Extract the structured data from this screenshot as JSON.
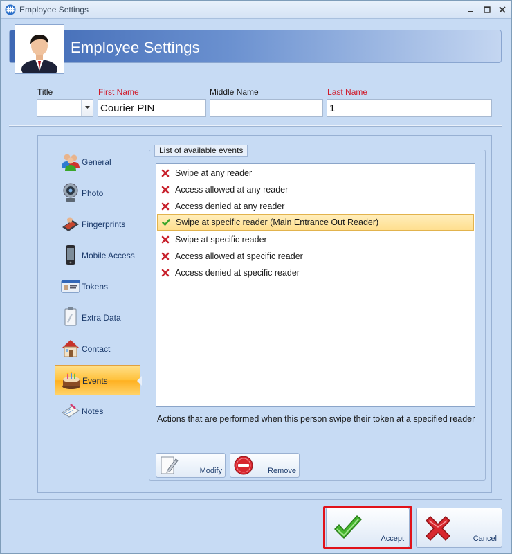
{
  "window": {
    "title": "Employee Settings"
  },
  "header": {
    "title": "Employee Settings"
  },
  "fields": {
    "title_label": "Title",
    "title_value": "",
    "first_name_label_prefix": "F",
    "first_name_label_rest": "irst Name",
    "first_name_value": "Courier PIN",
    "middle_name_label_prefix": "M",
    "middle_name_label_rest": "iddle Name",
    "middle_name_value": "",
    "last_name_label_prefix": "L",
    "last_name_label_rest": "ast Name",
    "last_name_value": "1"
  },
  "nav": {
    "items": [
      {
        "label": "General",
        "icon": "people-icon"
      },
      {
        "label": "Photo",
        "icon": "webcam-icon"
      },
      {
        "label": "Fingerprints",
        "icon": "fingerprint-scanner-icon"
      },
      {
        "label": "Mobile Access",
        "icon": "mobile-phone-icon"
      },
      {
        "label": "Tokens",
        "icon": "id-card-icon"
      },
      {
        "label": "Extra Data",
        "icon": "clipboard-icon"
      },
      {
        "label": "Contact",
        "icon": "house-icon"
      },
      {
        "label": "Events",
        "icon": "cake-icon"
      },
      {
        "label": "Notes",
        "icon": "notepad-icon"
      }
    ],
    "active": "Events"
  },
  "events": {
    "group_title": "List of available events",
    "items": [
      {
        "text": "Swipe at any reader",
        "status": "cross"
      },
      {
        "text": "Access allowed at any reader",
        "status": "cross"
      },
      {
        "text": "Access denied at any reader",
        "status": "cross"
      },
      {
        "text": "Swipe at specific reader (Main Entrance Out Reader)",
        "status": "check"
      },
      {
        "text": "Swipe at specific reader",
        "status": "cross"
      },
      {
        "text": "Access allowed at specific reader",
        "status": "cross"
      },
      {
        "text": "Access denied at specific reader",
        "status": "cross"
      }
    ],
    "selected_index": 3,
    "description": "Actions that are performed when this person swipe their token at a specified reader",
    "modify_label": "Modify",
    "remove_label": "Remove"
  },
  "footer": {
    "accept_prefix": "A",
    "accept_rest": "ccept",
    "cancel_prefix": "C",
    "cancel_rest": "ancel"
  },
  "colors": {
    "window_bg": "#c7dbf4",
    "required_label": "#d01a2a",
    "check": "#3aa62a",
    "cross": "#c8222d",
    "selection": "#ffdf8f",
    "highlight_border": "#e1121a"
  }
}
